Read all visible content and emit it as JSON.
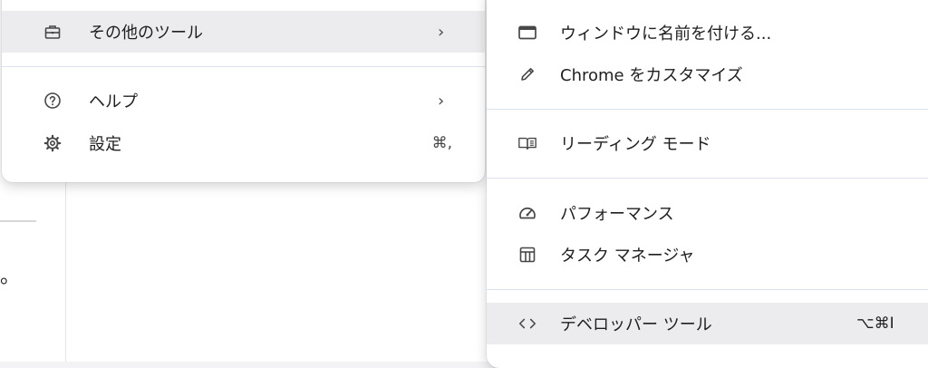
{
  "main_menu": {
    "more_tools": {
      "label": "その他のツール",
      "icon": "briefcase-icon",
      "chevron": "›"
    },
    "help": {
      "label": "ヘルプ",
      "icon": "help-circle-icon",
      "chevron": "›"
    },
    "settings": {
      "label": "設定",
      "icon": "gear-icon",
      "shortcut": "⌘,"
    }
  },
  "submenu": {
    "items": [
      {
        "label": "ウィンドウに名前を付ける...",
        "icon": "window-icon"
      },
      {
        "label": "Chrome をカスタマイズ",
        "icon": "pencil-icon"
      },
      {
        "label": "リーディング モード",
        "icon": "reading-mode-icon"
      },
      {
        "label": "パフォーマンス",
        "icon": "speedometer-icon"
      },
      {
        "label": "タスク マネージャ",
        "icon": "task-manager-icon"
      },
      {
        "label": "デベロッパー ツール",
        "icon": "code-brackets-icon",
        "shortcut": "⌥⌘I"
      }
    ]
  },
  "background": {
    "fragment_text": "。"
  },
  "colors": {
    "highlight": "#ececee",
    "separator": "#dce3ef",
    "text": "#1f1f1f",
    "icon": "#474747"
  }
}
